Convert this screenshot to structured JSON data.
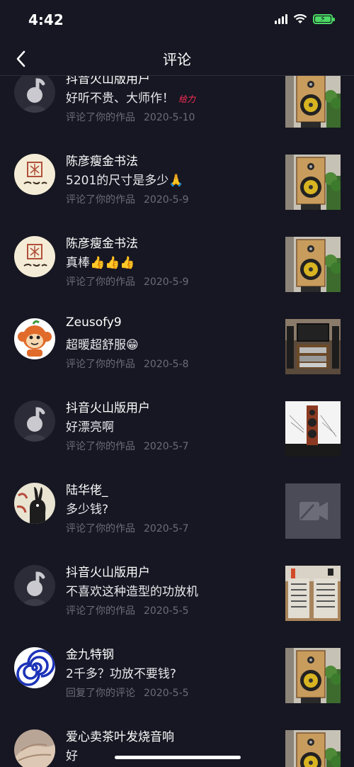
{
  "status_bar": {
    "time": "4:42",
    "icons": [
      "signal-icon",
      "wifi-icon",
      "battery-charging-icon"
    ]
  },
  "nav": {
    "title": "评论",
    "back_icon": "chevron-left-icon"
  },
  "items": [
    {
      "name": "抖音火山版用户",
      "comment": "好听不贵、大师作！",
      "badge": "给力",
      "action": "评论了你的作品",
      "date": "2020-5-10",
      "avatar": "default",
      "thumb": "speaker"
    },
    {
      "name": "陈彦瘦金书法",
      "comment": "5201的尺寸是多少🙏",
      "action": "评论了你的作品",
      "date": "2020-5-9",
      "avatar": "calligraphy",
      "thumb": "speaker"
    },
    {
      "name": "陈彦瘦金书法",
      "comment": "真棒👍👍👍",
      "action": "评论了你的作品",
      "date": "2020-5-9",
      "avatar": "calligraphy",
      "thumb": "speaker"
    },
    {
      "name": "Zeusofy9",
      "comment": "超暖超舒服😁",
      "action": "评论了你的作品",
      "date": "2020-5-8",
      "avatar": "monkey",
      "thumb": "hifi-room"
    },
    {
      "name": "抖音火山版用户",
      "comment": "好漂亮啊",
      "action": "评论了你的作品",
      "date": "2020-5-7",
      "avatar": "default",
      "thumb": "tall-speaker"
    },
    {
      "name": "陆华佬_",
      "comment": "多少钱?",
      "action": "评论了你的作品",
      "date": "2020-5-7",
      "avatar": "rabbit",
      "thumb": "video-placeholder"
    },
    {
      "name": "抖音火山版用户",
      "comment": "不喜欢这种造型的功放机",
      "action": "评论了你的作品",
      "date": "2020-5-5",
      "avatar": "default",
      "thumb": "amplifier"
    },
    {
      "name": "金九特钢",
      "comment": "2千多？功放不要钱?",
      "action": "回复了你的评论",
      "date": "2020-5-5",
      "avatar": "spiral",
      "thumb": "speaker"
    },
    {
      "name": "爱心卖茶叶发烧音响",
      "comment": "好",
      "action": "",
      "date": "",
      "avatar": "hands",
      "thumb": "speaker"
    }
  ],
  "colors": {
    "background": "#161722",
    "meta_text": "#6b6c77",
    "badge": "#fe2c55"
  }
}
